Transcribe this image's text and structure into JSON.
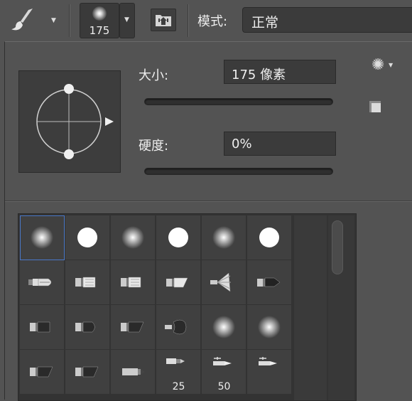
{
  "options_bar": {
    "tool_icon": "brush-icon",
    "preset_size": "175",
    "mode_label": "模式:",
    "mode_value": "正常"
  },
  "panel": {
    "size_label": "大小:",
    "size_value": "175 像素",
    "size_slider": 0.625,
    "hardness_label": "硬度:",
    "hardness_value": "0%",
    "hardness_slider": 0.0,
    "gear_icon": "gear-icon",
    "new_preset_icon": "new-preset-icon"
  },
  "presets": [
    {
      "kind": "soft",
      "label": ""
    },
    {
      "kind": "hard",
      "label": ""
    },
    {
      "kind": "soft",
      "label": ""
    },
    {
      "kind": "hard",
      "label": ""
    },
    {
      "kind": "soft",
      "label": ""
    },
    {
      "kind": "hard",
      "label": ""
    },
    {
      "kind": "brush-round-tip",
      "label": ""
    },
    {
      "kind": "brush-flat",
      "label": ""
    },
    {
      "kind": "brush-flat",
      "label": ""
    },
    {
      "kind": "brush-angle",
      "label": ""
    },
    {
      "kind": "brush-fan",
      "label": ""
    },
    {
      "kind": "brush-point",
      "label": ""
    },
    {
      "kind": "brush-flat-dark",
      "label": ""
    },
    {
      "kind": "brush-round-dark",
      "label": ""
    },
    {
      "kind": "brush-angle-dark",
      "label": ""
    },
    {
      "kind": "brush-sponge",
      "label": ""
    },
    {
      "kind": "soft",
      "label": ""
    },
    {
      "kind": "soft",
      "label": ""
    },
    {
      "kind": "brush-angle-dark",
      "label": ""
    },
    {
      "kind": "brush-angle-dark",
      "label": ""
    },
    {
      "kind": "brush-pencil",
      "label": ""
    },
    {
      "kind": "brush-pencil-thin",
      "label": "25"
    },
    {
      "kind": "brush-pen",
      "label": "50"
    },
    {
      "kind": "brush-pen",
      "label": ""
    }
  ]
}
